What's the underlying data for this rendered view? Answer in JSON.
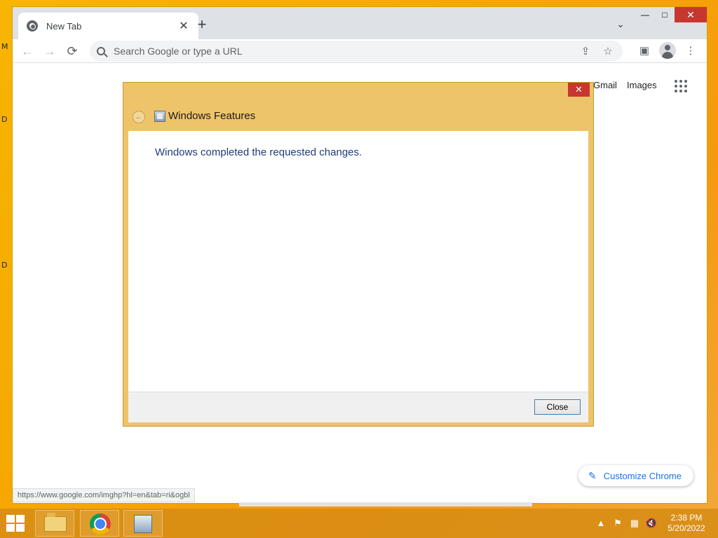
{
  "desktop": {
    "edge_labels": [
      "M",
      "D",
      "D"
    ]
  },
  "browser": {
    "tab_title": "New Tab",
    "tab_close": "✕",
    "new_tab": "+",
    "tab_search": "⌄",
    "window_controls": {
      "minimize": "—",
      "maximize": "□",
      "close": "✕"
    },
    "nav": {
      "back": "←",
      "forward": "→",
      "reload": "⟳"
    },
    "omnibox_placeholder": "Search Google or type a URL",
    "omnibox_share": "⇪",
    "omnibox_bookmark": "☆",
    "side_panel": "▣",
    "menu": "⋮"
  },
  "page": {
    "links": {
      "gmail": "Gmail",
      "images": "Images"
    },
    "customize_label": "Customize Chrome",
    "customize_icon": "✎",
    "status_url": "https://www.google.com/imghp?hl=en&tab=ri&ogbl"
  },
  "dialog": {
    "title": "Windows Features",
    "close_x": "✕",
    "back": "←",
    "message": "Windows completed the requested changes.",
    "close_button": "Close"
  },
  "taskbar": {
    "tray_up": "▲",
    "tray_flag": "⚑",
    "tray_network": "▦",
    "tray_volume": "🔇",
    "time": "2:38 PM",
    "date": "5/20/2022"
  }
}
